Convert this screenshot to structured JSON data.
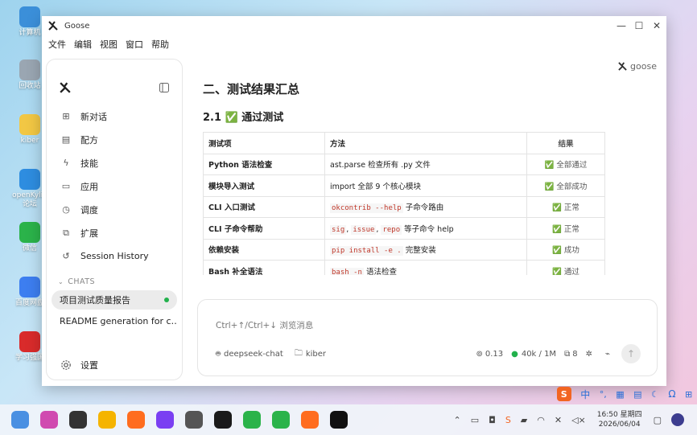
{
  "desktop": {
    "icons": [
      {
        "label": "计算机",
        "color": "#3b8fd9"
      },
      {
        "label": "回收站",
        "color": "#9aa6b2"
      },
      {
        "label": "kiber",
        "color": "#f2c744"
      },
      {
        "label": "openKylin论坛",
        "color": "#2e8de0"
      },
      {
        "label": "微信",
        "color": "#2bb34a"
      },
      {
        "label": "百度网盘",
        "color": "#3d7ef0"
      },
      {
        "label": "学习强国",
        "color": "#d92b2b"
      }
    ]
  },
  "window": {
    "title": "Goose",
    "controls": {
      "minimize": "—",
      "maximize": "☐",
      "close": "✕"
    },
    "menu": [
      "文件",
      "编辑",
      "视图",
      "窗口",
      "帮助"
    ]
  },
  "sidebar": {
    "nav": [
      {
        "label": "新对话",
        "icon": "new-chat-icon"
      },
      {
        "label": "配方",
        "icon": "recipe-icon"
      },
      {
        "label": "技能",
        "icon": "bolt-icon"
      },
      {
        "label": "应用",
        "icon": "app-window-icon"
      },
      {
        "label": "调度",
        "icon": "clock-icon"
      },
      {
        "label": "扩展",
        "icon": "puzzle-icon"
      },
      {
        "label": "Session History",
        "icon": "history-icon"
      }
    ],
    "chats_header": "CHATS",
    "chats": [
      {
        "label": "项目测试质量报告",
        "active": true
      },
      {
        "label": "README generation for c…",
        "active": false
      }
    ],
    "settings_label": "设置"
  },
  "brand": "goose",
  "content": {
    "heading": "二、测试结果汇总",
    "subheading": "2.1 ✅ 通过测试",
    "table": {
      "headers": [
        "测试项",
        "方法",
        "结果"
      ],
      "rows": [
        {
          "item": "Python 语法检查",
          "method": [
            {
              "t": "ast.parse 检查所有 .py 文件",
              "code": false
            }
          ],
          "result": "✅ 全部通过"
        },
        {
          "item": "模块导入测试",
          "method": [
            {
              "t": "import 全部 9 个核心模块",
              "code": false
            }
          ],
          "result": "✅ 全部成功"
        },
        {
          "item": "CLI 入口测试",
          "method": [
            {
              "t": "okcontrib --help",
              "code": true
            },
            {
              "t": " 子命令路由",
              "code": false
            }
          ],
          "result": "✅ 正常"
        },
        {
          "item": "CLI 子命令帮助",
          "method": [
            {
              "t": "sig",
              "code": true
            },
            {
              "t": ", ",
              "code": false
            },
            {
              "t": "issue",
              "code": true
            },
            {
              "t": ", ",
              "code": false
            },
            {
              "t": "repo",
              "code": true
            },
            {
              "t": " 等子命令 help",
              "code": false
            }
          ],
          "result": "✅ 正常"
        },
        {
          "item": "依赖安装",
          "method": [
            {
              "t": "pip install -e .",
              "code": true
            },
            {
              "t": " 完整安装",
              "code": false
            }
          ],
          "result": "✅ 成功"
        },
        {
          "item": "Bash 补全语法",
          "method": [
            {
              "t": "bash -n",
              "code": true
            },
            {
              "t": " 语法检查",
              "code": false
            }
          ],
          "result": "✅ 通过"
        }
      ]
    }
  },
  "composer": {
    "placeholder": "Ctrl+↑/Ctrl+↓ 浏览消息",
    "model": "deepseek-chat",
    "folder": "kiber",
    "cost": "0.13",
    "tokens": "40k / 1M",
    "extensions_count": "8"
  },
  "taskbar": {
    "time": "16:50 星期四",
    "date": "2026/06/04",
    "ime": "中",
    "accent": "#2b6fd6"
  }
}
